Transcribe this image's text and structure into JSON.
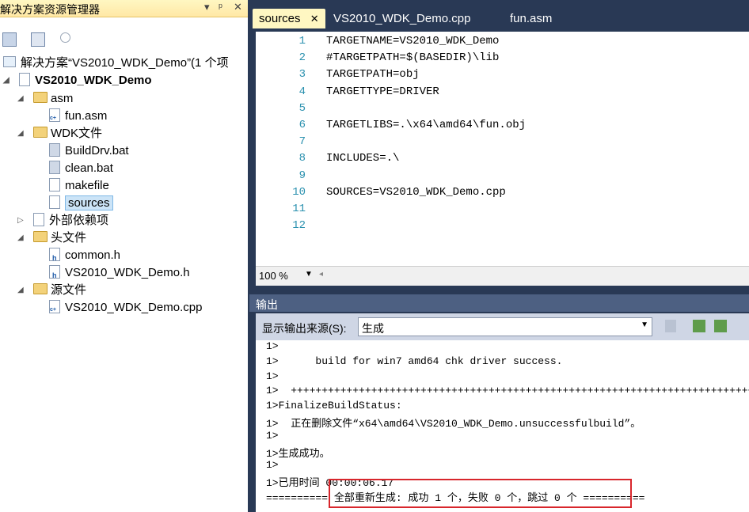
{
  "solution_explorer": {
    "title": "解决方案资源管理器",
    "title_controls": [
      "▾",
      "ᵖ",
      "✕"
    ],
    "solution": "解决方案“VS2010_WDK_Demo”(1 个项",
    "project": "VS2010_WDK_Demo",
    "folders": {
      "asm": "asm",
      "wdk": "WDK文件",
      "external": "外部依赖项",
      "headers": "头文件",
      "sources": "源文件"
    },
    "files": {
      "fun_asm": "fun.asm",
      "builddrv": "BuildDrv.bat",
      "clean": "clean.bat",
      "makefile": "makefile",
      "sources": "sources",
      "common_h": "common.h",
      "demo_h": "VS2010_WDK_Demo.h",
      "demo_cpp": "VS2010_WDK_Demo.cpp"
    }
  },
  "editor": {
    "tabs": [
      {
        "label": "sources",
        "close": "✕"
      },
      {
        "label": "VS2010_WDK_Demo.cpp"
      },
      {
        "label": "fun.asm"
      }
    ],
    "lines": [
      {
        "n": "1",
        "text": "TARGETNAME=VS2010_WDK_Demo"
      },
      {
        "n": "2",
        "text": "#TARGETPATH=$(BASEDIR)\\lib"
      },
      {
        "n": "3",
        "text": "TARGETPATH=obj"
      },
      {
        "n": "4",
        "text": "TARGETTYPE=DRIVER"
      },
      {
        "n": "5",
        "text": ""
      },
      {
        "n": "6",
        "text": "TARGETLIBS=.\\x64\\amd64\\fun.obj"
      },
      {
        "n": "7",
        "text": ""
      },
      {
        "n": "8",
        "text": "INCLUDES=.\\"
      },
      {
        "n": "9",
        "text": ""
      },
      {
        "n": "10",
        "text": "SOURCES=VS2010_WDK_Demo.cpp"
      },
      {
        "n": "11",
        "text": ""
      },
      {
        "n": "12",
        "text": ""
      }
    ],
    "zoom": "100 %"
  },
  "output": {
    "title": "输出",
    "source_label": "显示输出来源(S):",
    "source_value": "生成",
    "lines": [
      "1>",
      "1>      build for win7 amd64 chk driver success.",
      "1>",
      "1>  ++++++++++++++++++++++++++++++++++++++++++++++++++++++++++++++++++++++++++++",
      "1>FinalizeBuildStatus:",
      "1>  正在删除文件“x64\\amd64\\VS2010_WDK_Demo.unsuccessfulbuild”。",
      "1>",
      "1>生成成功。",
      "1>",
      "1>已用时间 00:00:06.17",
      "========== 全部重新生成: 成功 1 个，失败 0 个，跳过 0 个 =========="
    ]
  },
  "colors": {
    "chrome": "#293955",
    "highlight_box": "#d8262c",
    "line_numbers": "#2b91af"
  }
}
